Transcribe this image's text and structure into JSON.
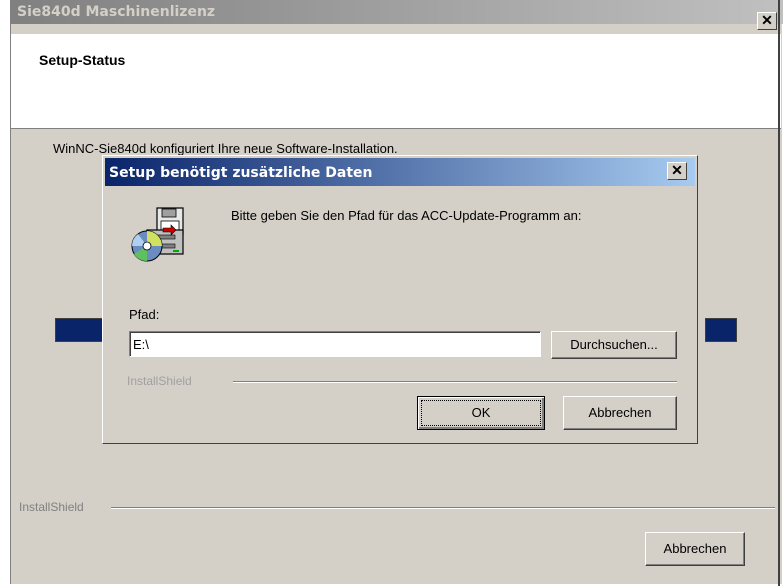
{
  "outer_window": {
    "title": "Sie840d Maschinenlizenz",
    "close_glyph": "✕",
    "header_title": "Setup-Status",
    "status_text": "WinNC-Sie840d konfiguriert Ihre neue Software-Installation.",
    "brand": "InstallShield",
    "cancel_label": "Abbrechen"
  },
  "dialog": {
    "title": "Setup benötigt zusätzliche Daten",
    "close_glyph": "✕",
    "icon": "setup-disk-icon",
    "prompt": "Bitte geben Sie den Pfad für das ACC-Update-Programm an:",
    "path_label": "Pfad:",
    "path_value": "E:\\",
    "browse_label": "Durchsuchen...",
    "brand": "InstallShield",
    "ok_label": "OK",
    "cancel_label": "Abbrechen"
  }
}
